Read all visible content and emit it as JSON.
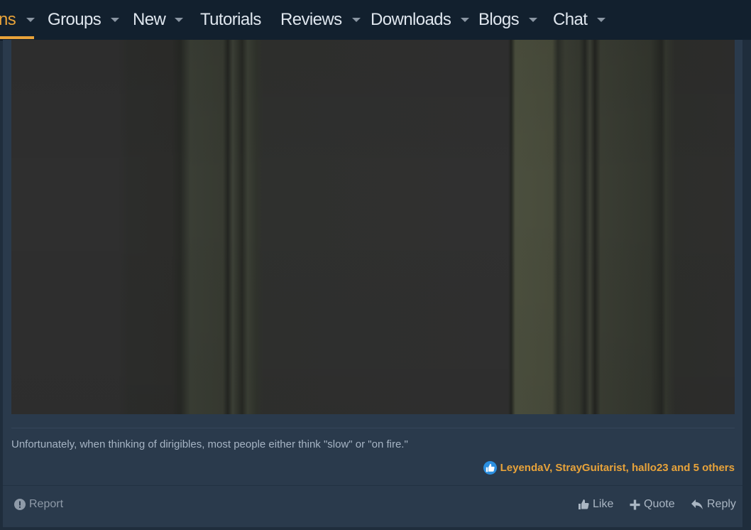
{
  "nav": {
    "items": [
      {
        "label": "ns",
        "has_menu": true,
        "active": true
      },
      {
        "label": "Groups",
        "has_menu": true
      },
      {
        "label": "New",
        "has_menu": true
      },
      {
        "label": "Tutorials",
        "has_menu": false
      },
      {
        "label": "Reviews",
        "has_menu": true
      },
      {
        "label": "Downloads",
        "has_menu": true
      },
      {
        "label": "Blogs",
        "has_menu": true
      },
      {
        "label": "Chat",
        "has_menu": true
      }
    ]
  },
  "post": {
    "signature": "Unfortunately, when thinking of dirigibles, most people either think \"slow\" or \"on fire.\"",
    "reactions": {
      "icon": "thumbs-up-icon",
      "text": "LeyendaV, StrayGuitarist, hallo23 and 5 others"
    },
    "actions": {
      "report": "Report",
      "like": "Like",
      "quote": "Quote",
      "reply": "Reply"
    }
  },
  "colors": {
    "nav_bg": "#12202e",
    "post_bg": "#2a3a4c",
    "accent": "#e8a33a",
    "reaction_blue": "#2b8fe0"
  }
}
